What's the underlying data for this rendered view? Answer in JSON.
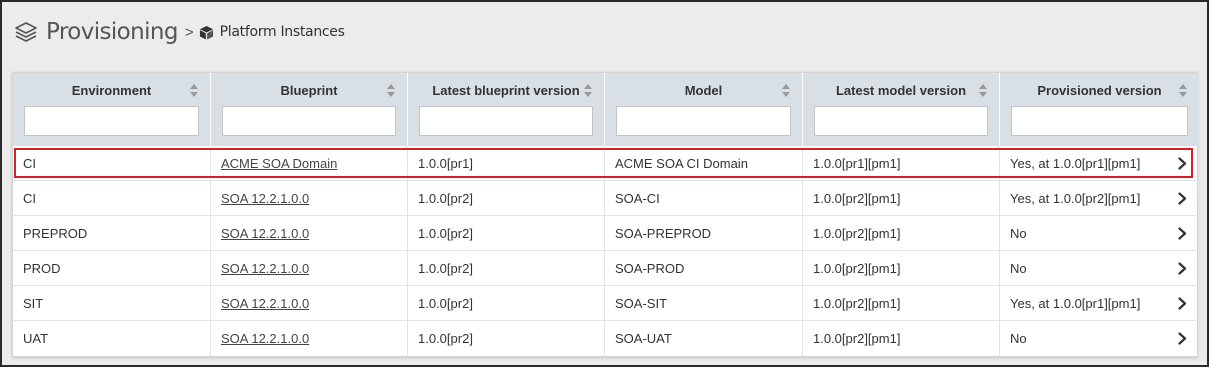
{
  "breadcrumb": {
    "title": "Provisioning",
    "separator": ">",
    "current": "Platform Instances",
    "title_icon": "layers-icon",
    "current_icon": "cube-icon"
  },
  "table": {
    "columns": [
      {
        "label": "Environment"
      },
      {
        "label": "Blueprint"
      },
      {
        "label": "Latest blueprint version"
      },
      {
        "label": "Model"
      },
      {
        "label": "Latest model version"
      },
      {
        "label": "Provisioned version"
      }
    ],
    "filters": [
      "",
      "",
      "",
      "",
      "",
      ""
    ],
    "rows": [
      {
        "environment": "CI",
        "blueprint": "ACME SOA Domain",
        "latest_blueprint_version": "1.0.0[pr1]",
        "model": "ACME SOA CI Domain",
        "latest_model_version": "1.0.0[pr1][pm1]",
        "provisioned_version": "Yes, at 1.0.0[pr1][pm1]",
        "highlighted": true
      },
      {
        "environment": "CI",
        "blueprint": "SOA 12.2.1.0.0",
        "latest_blueprint_version": "1.0.0[pr2]",
        "model": "SOA-CI",
        "latest_model_version": "1.0.0[pr2][pm1]",
        "provisioned_version": "Yes, at 1.0.0[pr2][pm1]"
      },
      {
        "environment": "PREPROD",
        "blueprint": "SOA 12.2.1.0.0",
        "latest_blueprint_version": "1.0.0[pr2]",
        "model": "SOA-PREPROD",
        "latest_model_version": "1.0.0[pr2][pm1]",
        "provisioned_version": "No"
      },
      {
        "environment": "PROD",
        "blueprint": "SOA 12.2.1.0.0",
        "latest_blueprint_version": "1.0.0[pr2]",
        "model": "SOA-PROD",
        "latest_model_version": "1.0.0[pr2][pm1]",
        "provisioned_version": "No"
      },
      {
        "environment": "SIT",
        "blueprint": "SOA 12.2.1.0.0",
        "latest_blueprint_version": "1.0.0[pr2]",
        "model": "SOA-SIT",
        "latest_model_version": "1.0.0[pr2][pm1]",
        "provisioned_version": "Yes, at 1.0.0[pr1][pm1]"
      },
      {
        "environment": "UAT",
        "blueprint": "SOA 12.2.1.0.0",
        "latest_blueprint_version": "1.0.0[pr2]",
        "model": "SOA-UAT",
        "latest_model_version": "1.0.0[pr2][pm1]",
        "provisioned_version": "No"
      }
    ],
    "row_action_icon": "chevron-right-icon",
    "sort_icon": "sort-icon"
  },
  "colors": {
    "header_bg": "#d9e0e5",
    "highlight_border": "#d62024",
    "page_bg": "#ececec"
  }
}
